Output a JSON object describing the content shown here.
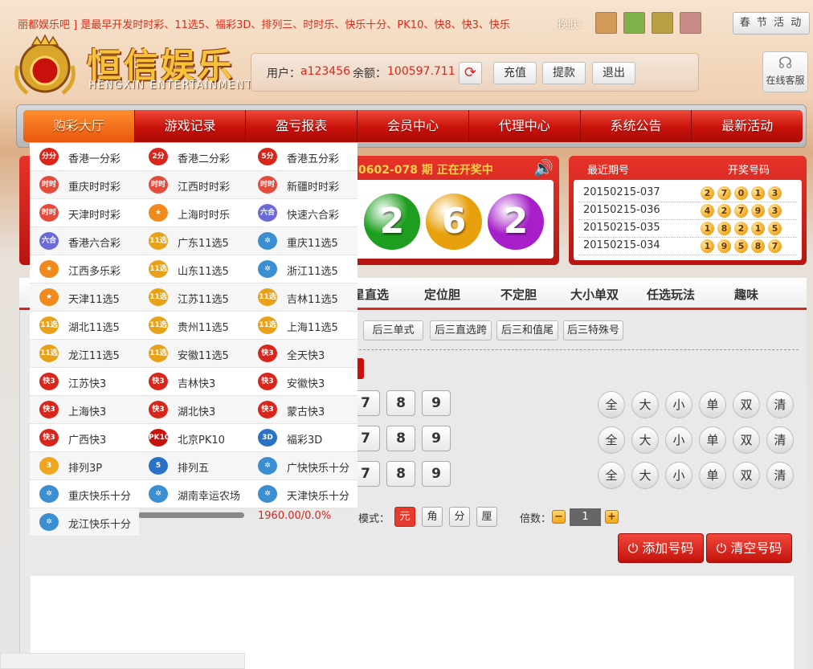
{
  "header": {
    "marquee": "丽都娱乐吧 ] 是最早开发时时彩、11选5、福彩3D、排列三、时时乐、快乐十分、PK10、快8、快3、快乐",
    "skin_label": "换肤：",
    "skins": [
      "#d49a5a",
      "#7fb24a",
      "#b9a044",
      "#c98a8a"
    ],
    "spring_event": "春 节 活 动",
    "logo_title": "恒信娱乐",
    "logo_subtitle": "HENGXIN ENTERTAINMENT",
    "customer_service": "在线客服"
  },
  "user": {
    "user_label": "用户：",
    "username": "a123456",
    "balance_label": "余额：",
    "balance": "100597.711",
    "recharge": "充值",
    "withdraw": "提款",
    "logout": "退出"
  },
  "nav": [
    "购彩大厅",
    "游戏记录",
    "盈亏报表",
    "会员中心",
    "代理中心",
    "系统公告",
    "最新活动"
  ],
  "draw": {
    "issue_text": "0602-078 期  正在开奖中",
    "balls": [
      {
        "value": "2",
        "color": "#1e9e1e"
      },
      {
        "value": "6",
        "color": "#e7a10c"
      },
      {
        "value": "2",
        "color": "#a61fc9"
      }
    ]
  },
  "recent": {
    "header_issue": "最近期号",
    "header_numbers": "开奖号码",
    "rows": [
      {
        "issue": "20150215-037",
        "numbers": [
          "2",
          "7",
          "0",
          "1",
          "3"
        ]
      },
      {
        "issue": "20150215-036",
        "numbers": [
          "4",
          "2",
          "7",
          "9",
          "3"
        ]
      },
      {
        "issue": "20150215-035",
        "numbers": [
          "1",
          "8",
          "2",
          "1",
          "5"
        ]
      },
      {
        "issue": "20150215-034",
        "numbers": [
          "1",
          "9",
          "5",
          "8",
          "7"
        ]
      }
    ]
  },
  "play_tabs": [
    "星直选",
    "定位胆",
    "不定胆",
    "大小单双",
    "任选玩法",
    "趣味"
  ],
  "sub_buttons": [
    "后三单式",
    "后三直选跨",
    "后三和值尾",
    "后三特殊号"
  ],
  "number_rows": [
    [
      "7",
      "8",
      "9"
    ],
    [
      "7",
      "8",
      "9"
    ],
    [
      "7",
      "8",
      "9"
    ]
  ],
  "quick_buttons": [
    "全",
    "大",
    "小",
    "单",
    "双",
    "清"
  ],
  "rebate": "1960.00/0.0%",
  "mode_label": "模式：",
  "modes": [
    "元",
    "角",
    "分",
    "厘"
  ],
  "multiplier_label": "倍数：",
  "multiplier_value": "1",
  "add_number": "添加号码",
  "clear_numbers": "清空号码",
  "menu": [
    {
      "label": "香港一分彩",
      "icon": "分分彩",
      "color": "#d8261c"
    },
    {
      "label": "香港二分彩",
      "icon": "2分彩",
      "color": "#d8261c"
    },
    {
      "label": "香港五分彩",
      "icon": "5分彩",
      "color": "#d8261c"
    },
    {
      "label": "重庆时时彩",
      "icon": "时时彩",
      "color": "#e44b3c"
    },
    {
      "label": "江西时时彩",
      "icon": "时时彩",
      "color": "#e44b3c"
    },
    {
      "label": "新疆时时彩",
      "icon": "时时彩",
      "color": "#e44b3c"
    },
    {
      "label": "天津时时彩",
      "icon": "时时彩",
      "color": "#e44b3c"
    },
    {
      "label": "上海时时乐",
      "icon": "★",
      "color": "#f08a1c"
    },
    {
      "label": "快速六合彩",
      "icon": "六合彩",
      "color": "#6a6ad8"
    },
    {
      "label": "香港六合彩",
      "icon": "六合彩",
      "color": "#6a6ad8"
    },
    {
      "label": "广东11选5",
      "icon": "11选5",
      "color": "#e8a21a"
    },
    {
      "label": "重庆11选5",
      "icon": "✲",
      "color": "#3b8ed0"
    },
    {
      "label": "江西多乐彩",
      "icon": "★",
      "color": "#f08a1c"
    },
    {
      "label": "山东11选5",
      "icon": "11选5",
      "color": "#e8a21a"
    },
    {
      "label": "浙江11选5",
      "icon": "✲",
      "color": "#3b8ed0"
    },
    {
      "label": "天津11选5",
      "icon": "★",
      "color": "#f08a1c"
    },
    {
      "label": "江苏11选5",
      "icon": "11选5",
      "color": "#e8a21a"
    },
    {
      "label": "吉林11选5",
      "icon": "11选5",
      "color": "#e8a21a"
    },
    {
      "label": "湖北11选5",
      "icon": "11选5",
      "color": "#e8a21a"
    },
    {
      "label": "贵州11选5",
      "icon": "11选5",
      "color": "#e8a21a"
    },
    {
      "label": "上海11选5",
      "icon": "11选5",
      "color": "#e8a21a"
    },
    {
      "label": "龙江11选5",
      "icon": "11选5",
      "color": "#e8a21a"
    },
    {
      "label": "安徽11选5",
      "icon": "11选5",
      "color": "#e8a21a"
    },
    {
      "label": "全天快3",
      "icon": "快3",
      "color": "#d8261c"
    },
    {
      "label": "江苏快3",
      "icon": "快3",
      "color": "#d8261c"
    },
    {
      "label": "吉林快3",
      "icon": "快3",
      "color": "#d8261c"
    },
    {
      "label": "安徽快3",
      "icon": "快3",
      "color": "#d8261c"
    },
    {
      "label": "上海快3",
      "icon": "快3",
      "color": "#d8261c"
    },
    {
      "label": "湖北快3",
      "icon": "快3",
      "color": "#d8261c"
    },
    {
      "label": "蒙古快3",
      "icon": "快3",
      "color": "#d8261c"
    },
    {
      "label": "广西快3",
      "icon": "快3",
      "color": "#d8261c"
    },
    {
      "label": "北京PK10",
      "icon": "PK10",
      "color": "#c8110a"
    },
    {
      "label": "福彩3D",
      "icon": "3D",
      "color": "#2a72c8"
    },
    {
      "label": "排列3P",
      "icon": "3",
      "color": "#f0a51e"
    },
    {
      "label": "排列五",
      "icon": "5",
      "color": "#2a72c8"
    },
    {
      "label": "广快快乐十分",
      "icon": "✲",
      "color": "#3b8ed0"
    },
    {
      "label": "重庆快乐十分",
      "icon": "✲",
      "color": "#3b8ed0"
    },
    {
      "label": "湖南幸运农场",
      "icon": "✲",
      "color": "#3b8ed0"
    },
    {
      "label": "天津快乐十分",
      "icon": "✲",
      "color": "#3b8ed0"
    },
    {
      "label": "龙江快乐十分",
      "icon": "✲",
      "color": "#3b8ed0"
    }
  ]
}
